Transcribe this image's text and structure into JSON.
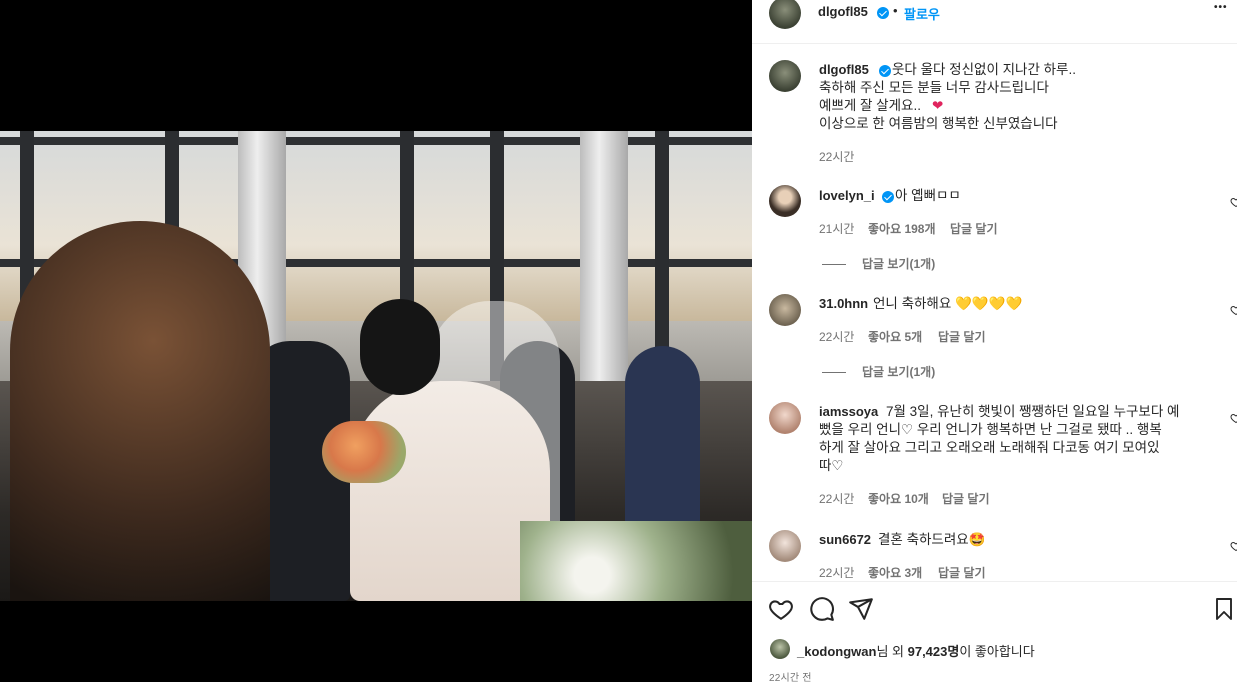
{
  "post": {
    "author": "dlgofl85",
    "follow_label": "팔로우",
    "separator": "•",
    "more_label": "•••"
  },
  "caption": {
    "username": "dlgofl85",
    "text": "웃다 울다 정신없이 지나간 하루..",
    "line2": "축하해 주신 모든 분들 너무 감사드립니다",
    "line3": "예쁘게 잘 살게요..",
    "line3_emoji": "❤",
    "line4": "이상으로 한 여름밤의 행복한 신부였습니다",
    "time": "22시간"
  },
  "comments": [
    {
      "username": "lovelyn_i",
      "verified": true,
      "text": "아 옙뻐ㅁㅁ",
      "time": "21시간",
      "likes": "좋아요 198개",
      "reply": "답글 달기",
      "view_replies": "답글 보기(1개)"
    },
    {
      "username": "31.0hnn",
      "verified": false,
      "text": "언니 축하해요 💛💛💛💛",
      "time": "22시간",
      "likes": "좋아요 5개",
      "reply": "답글 달기",
      "view_replies": "답글 보기(1개)"
    },
    {
      "username": "iamssoya",
      "verified": false,
      "text_line1": "7월 3일, 유난히 햇빛이 쨍쨍하던 일요일 누구보다 예",
      "text_line2": "뻤을 우리 언니♡ 우리 언니가 행복하면 난 그걸로 됐따 .. 행복",
      "text_line3": "하게 잘 살아요 그리고 오래오래 노래해줘 다코동 여기 모여있",
      "text_line4": "따♡",
      "time": "22시간",
      "likes": "좋아요 10개",
      "reply": "답글 달기"
    },
    {
      "username": "sun6672",
      "verified": false,
      "text": "결혼 축하드려요🤩",
      "time": "22시간",
      "likes": "좋아요 3개",
      "reply": "답글 달기"
    }
  ],
  "footer": {
    "liked_by_user": "_kodongwan",
    "liked_by_mid": "님 외 ",
    "liked_count": "97,423명",
    "liked_suffix": "이 좋아합니다",
    "time": "22시간 전"
  },
  "colors": {
    "accent": "#0095f6",
    "text": "#262626",
    "secondary": "#737373",
    "heart": "#e0245e"
  }
}
